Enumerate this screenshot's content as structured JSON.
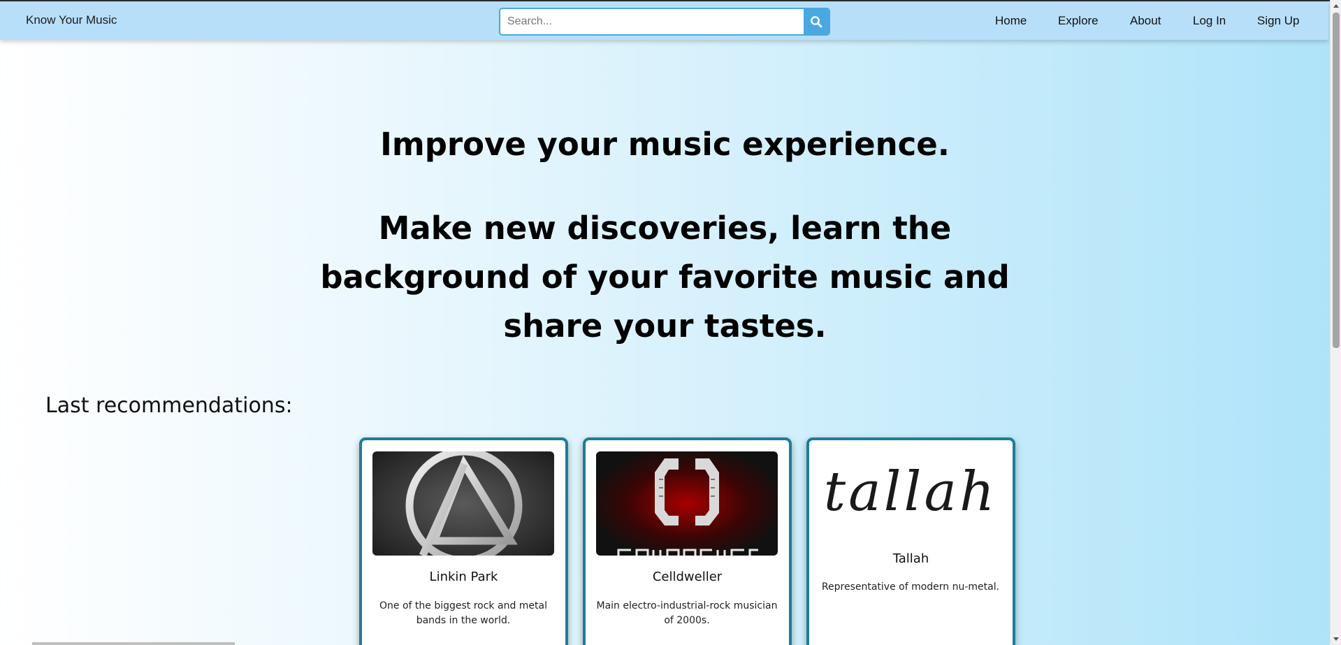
{
  "brand": "Know Your Music",
  "search": {
    "placeholder": "Search..."
  },
  "nav": {
    "home": "Home",
    "explore": "Explore",
    "about": "About",
    "login": "Log In",
    "signup": "Sign Up"
  },
  "hero": {
    "line1": "Improve your music experience.",
    "line2": "Make new discoveries, learn the background of your favorite music and share your tastes."
  },
  "recommendations": {
    "label": "Last recommendations:",
    "cards": [
      {
        "name": "Linkin Park",
        "description": "One of the biggest rock and metal bands in the world.",
        "logo": "linkin-park-logo"
      },
      {
        "name": "Celldweller",
        "description": "Main electro-industrial-rock musician of 2000s.",
        "logo": "celldweller-logo"
      },
      {
        "name": "Tallah",
        "description": "Representative of modern nu-metal.",
        "logo": "tallah-logo",
        "logo_text": "tallah"
      }
    ]
  },
  "colors": {
    "navbar": "#b7dffa",
    "accent": "#4aa8e0",
    "card_border": "#1e7d97"
  }
}
